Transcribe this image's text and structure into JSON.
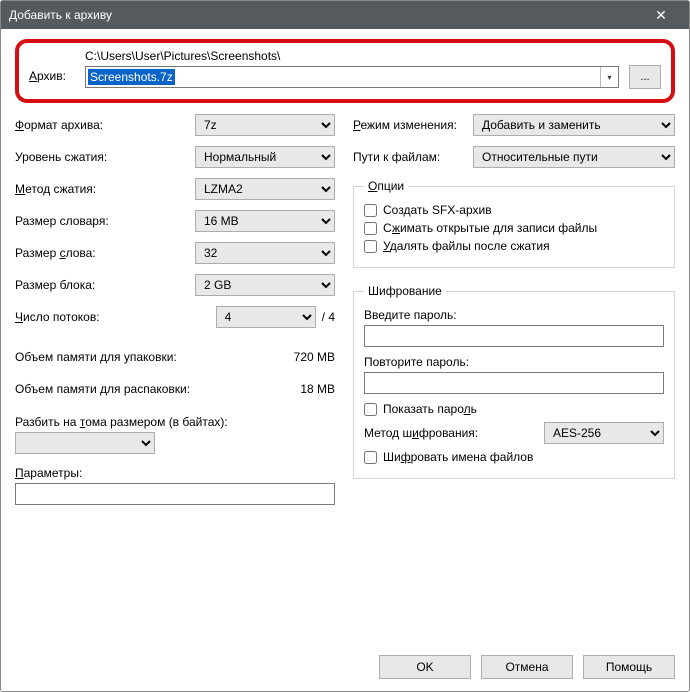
{
  "titlebar": {
    "title": "Добавить к архиву"
  },
  "archive": {
    "label": "Архив:",
    "path": "C:\\Users\\User\\Pictures\\Screenshots\\",
    "filename": "Screenshots.7z",
    "browse": "..."
  },
  "left": {
    "format_label": "Формат архива:",
    "format_value": "7z",
    "level_label": "Уровень сжатия:",
    "level_value": "Нормальный",
    "method_label": "Метод сжатия:",
    "method_value": "LZMA2",
    "dict_label": "Размер словаря:",
    "dict_value": "16 MB",
    "word_label": "Размер слова:",
    "word_value": "32",
    "block_label": "Размер блока:",
    "block_value": "2 GB",
    "threads_label": "Число потоков:",
    "threads_value": "4",
    "threads_max": "/ 4",
    "mem_pack_label": "Объем памяти для упаковки:",
    "mem_pack_value": "720 MB",
    "mem_unpack_label": "Объем памяти для распаковки:",
    "mem_unpack_value": "18 MB",
    "split_label": "Разбить на тома размером (в байтах):",
    "params_label": "Параметры:"
  },
  "right": {
    "update_label": "Режим изменения:",
    "update_value": "Добавить и заменить",
    "paths_label": "Пути к файлам:",
    "paths_value": "Относительные пути",
    "options_legend": "Опции",
    "sfx_label": "Создать SFX-архив",
    "share_label": "Сжимать открытые для записи файлы",
    "delete_label": "Удалять файлы после сжатия",
    "enc_legend": "Шифрование",
    "pwd_label": "Введите пароль:",
    "pwd2_label": "Повторите пароль:",
    "showpwd_label": "Показать пароль",
    "encmethod_label": "Метод шифрования:",
    "encmethod_value": "AES-256",
    "encnames_label": "Шифровать имена файлов"
  },
  "buttons": {
    "ok": "OK",
    "cancel": "Отмена",
    "help": "Помощь"
  }
}
